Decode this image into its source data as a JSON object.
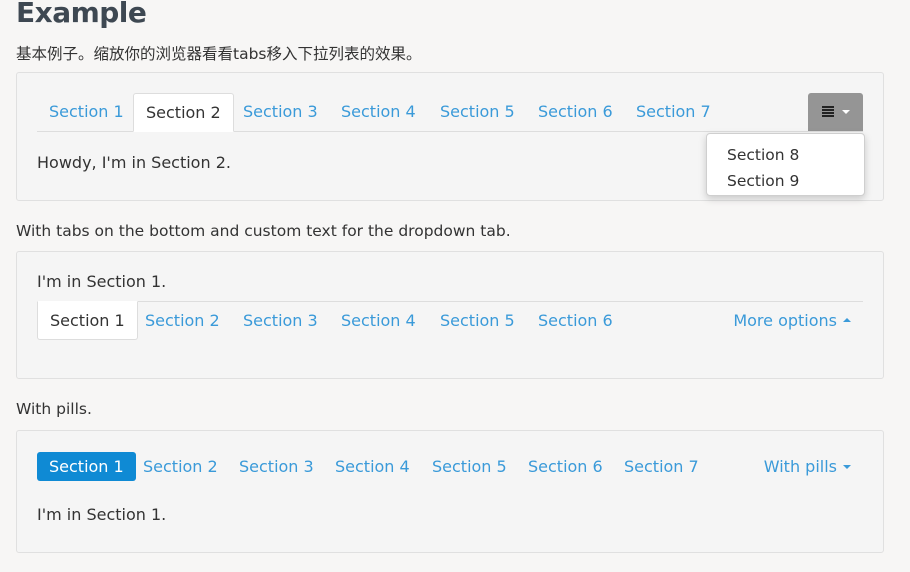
{
  "page": {
    "title": "Example",
    "description": "基本例子。缩放你的浏览器看看tabs移入下拉列表的效果。"
  },
  "example1": {
    "tabs": [
      "Section 1",
      "Section 2",
      "Section 3",
      "Section 4",
      "Section 5",
      "Section 6",
      "Section 7"
    ],
    "active_tab": "Section 2",
    "menu_icon": "list-bars-icon",
    "dropdown_items": [
      "Section 8",
      "Section 9"
    ],
    "content": "Howdy, I'm in Section 2."
  },
  "example2": {
    "description": "With tabs on the bottom and custom text for the dropdown tab.",
    "content": "I'm in Section 1.",
    "tabs": [
      "Section 1",
      "Section 2",
      "Section 3",
      "Section 4",
      "Section 5",
      "Section 6"
    ],
    "active_tab": "Section 1",
    "more_label": "More options"
  },
  "example3": {
    "description": "With pills.",
    "pills": [
      "Section 1",
      "Section 2",
      "Section 3",
      "Section 4",
      "Section 5",
      "Section 6",
      "Section 7"
    ],
    "active_pill": "Section 1",
    "more_label": "With pills",
    "content": "I'm in Section 1."
  },
  "colors": {
    "link": "#3a9ad9",
    "pill_active": "#0f8ad4",
    "menu_button": "#959595",
    "title": "#3e4852"
  }
}
